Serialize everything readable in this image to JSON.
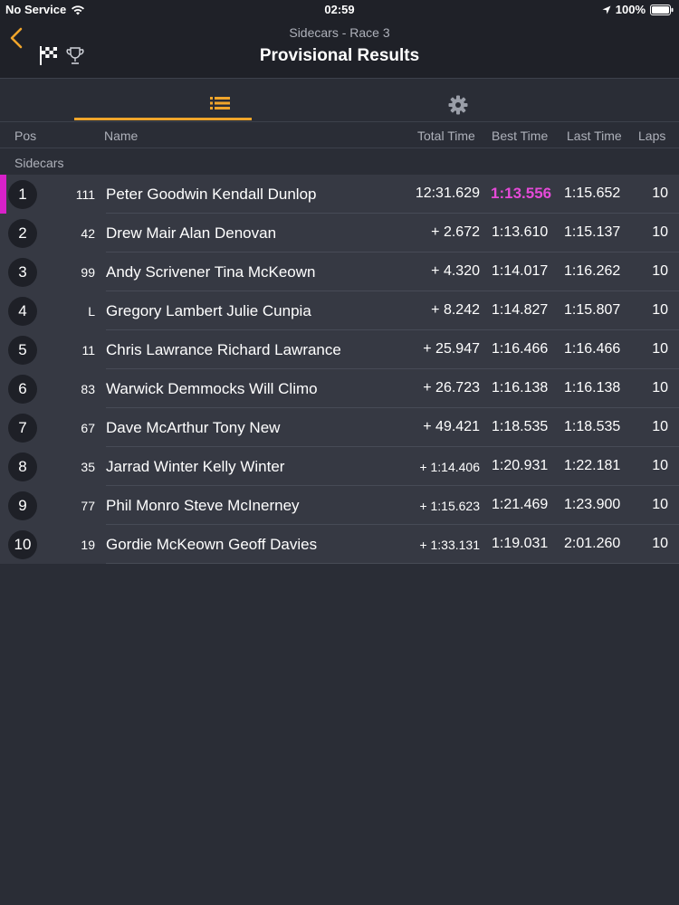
{
  "status": {
    "carrier": "No Service",
    "time": "02:59",
    "battery": "100%"
  },
  "header": {
    "subtitle": "Sidecars - Race 3",
    "title": "Provisional Results"
  },
  "colors": {
    "accent": "#f0a52b",
    "highlight": "#e54ad8"
  },
  "columns": {
    "pos": "Pos",
    "name": "Name",
    "total": "Total Time",
    "best": "Best Time",
    "last": "Last Time",
    "laps": "Laps"
  },
  "group": "Sidecars",
  "results": [
    {
      "pos": "1",
      "num": "111",
      "name": "Peter Goodwin Kendall Dunlop",
      "total": "12:31.629",
      "best": "1:13.556",
      "last": "1:15.652",
      "laps": "10"
    },
    {
      "pos": "2",
      "num": "42",
      "name": "Drew Mair Alan Denovan",
      "total": "+ 2.672",
      "best": "1:13.610",
      "last": "1:15.137",
      "laps": "10"
    },
    {
      "pos": "3",
      "num": "99",
      "name": "Andy Scrivener Tina McKeown",
      "total": "+ 4.320",
      "best": "1:14.017",
      "last": "1:16.262",
      "laps": "10"
    },
    {
      "pos": "4",
      "num": "L",
      "name": "Gregory Lambert Julie Cunpia",
      "total": "+ 8.242",
      "best": "1:14.827",
      "last": "1:15.807",
      "laps": "10"
    },
    {
      "pos": "5",
      "num": "11",
      "name": "Chris Lawrance Richard Lawrance",
      "total": "+ 25.947",
      "best": "1:16.466",
      "last": "1:16.466",
      "laps": "10"
    },
    {
      "pos": "6",
      "num": "83",
      "name": "Warwick Demmocks Will Climo",
      "total": "+ 26.723",
      "best": "1:16.138",
      "last": "1:16.138",
      "laps": "10"
    },
    {
      "pos": "7",
      "num": "67",
      "name": "Dave McArthur Tony New",
      "total": "+ 49.421",
      "best": "1:18.535",
      "last": "1:18.535",
      "laps": "10"
    },
    {
      "pos": "8",
      "num": "35",
      "name": "Jarrad Winter Kelly Winter",
      "total": "+ 1:14.406",
      "best": "1:20.931",
      "last": "1:22.181",
      "laps": "10"
    },
    {
      "pos": "9",
      "num": "77",
      "name": "Phil Monro Steve McInerney",
      "total": "+ 1:15.623",
      "best": "1:21.469",
      "last": "1:23.900",
      "laps": "10"
    },
    {
      "pos": "10",
      "num": "19",
      "name": "Gordie McKeown Geoff Davies",
      "total": "+ 1:33.131",
      "best": "1:19.031",
      "last": "2:01.260",
      "laps": "10"
    }
  ]
}
